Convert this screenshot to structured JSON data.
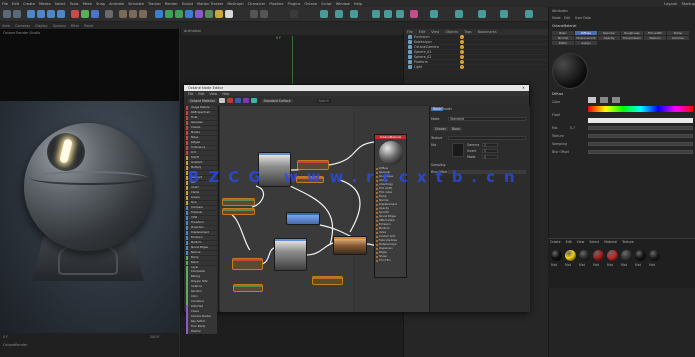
{
  "menubar": [
    "File",
    "Edit",
    "Create",
    "Modes",
    "Select",
    "Tools",
    "Mesh",
    "Snap",
    "Animate",
    "Simulate",
    "Tracker",
    "Render",
    "Sculpt",
    "Motion Tracker",
    "MoGraph",
    "Character",
    "Pipeline",
    "Plugins",
    "Octane",
    "Script",
    "Window",
    "Help"
  ],
  "layout_label": "Layout:",
  "layout_value": "Startup",
  "subbar": [
    "View",
    "Cameras",
    "Display",
    "Options",
    "Filter",
    "Panel"
  ],
  "viewport_top_label": "Octane Render Studio",
  "timeline": {
    "left": "0 F",
    "right": "200 F",
    "status": "OctaneRender"
  },
  "center_tab": "Animation",
  "center_marker": "0 F",
  "object_manager": {
    "menu": [
      "File",
      "Edit",
      "View",
      "Objects",
      "Tags",
      "Bookmarks"
    ],
    "rows": [
      "Environm",
      "Koleksiyon",
      "OctaneCamera",
      "Sphere_01",
      "Sphere_02",
      "Platform",
      "Light"
    ]
  },
  "attributes": {
    "title": "Attributes",
    "mode_tabs": [
      "Mode",
      "Edit",
      "User Data"
    ],
    "mat_name": "OctaneMaterial",
    "tabs": [
      "Basic",
      "Diffuse",
      "Specular",
      "Roughness",
      "Film width",
      "Bump",
      "Normal",
      "Displacement",
      "Opacity",
      "Transmission",
      "Medium",
      "Common",
      "Editor",
      "Assign"
    ],
    "section": "Diffuse",
    "rows": [
      "Color",
      "Float",
      "Mix",
      "Texture"
    ],
    "float_value": "0.7",
    "sampling_label": "Sampling",
    "blur_label": "Blur Offset"
  },
  "material_panel": {
    "tabs": [
      "Create",
      "Edit",
      "View",
      "Select",
      "Material",
      "Texture"
    ],
    "materials": [
      {
        "color": "#111111",
        "name": "Mat"
      },
      {
        "color": "#f2d21a",
        "name": "Mat"
      },
      {
        "color": "#2a2a2a",
        "name": "Mat"
      },
      {
        "color": "#a31d1d",
        "name": "Mat"
      },
      {
        "color": "#c12828",
        "name": "Mat"
      },
      {
        "color": "#3a3a3a",
        "name": "Mat"
      },
      {
        "color": "#151515",
        "name": "Mat"
      },
      {
        "color": "#1e1e1e",
        "name": "Mat"
      }
    ]
  },
  "node_editor": {
    "title": "Octane Node Editor",
    "menu": [
      "File",
      "Edit",
      "View",
      "Help"
    ],
    "toolbar_labels": [
      "Octane Material",
      "Diffuse",
      "Glossy",
      "Specular",
      "Standard Surface"
    ],
    "search_label": "Search",
    "node_list": [
      "Image Texture",
      "RGB Spectrum",
      "Float",
      "Gaussian",
      "Checks",
      "Marble",
      "Noise",
      "Ridged",
      "Turbulence",
      "Dirt",
      "Falloff",
      "Gradient",
      "Multiply",
      "Add",
      "Subtract",
      "Mix",
      "Invert",
      "Clamp",
      "Cosine",
      "Sine",
      "Compare",
      "Triplanar",
      "UVW",
      "Transform",
      "Projection",
      "Displacement",
      "Emission",
      "Medium",
      "Round Edges",
      "Normal",
      "Bump",
      "Blend",
      "Layer",
      "Composite",
      "Baking",
      "Polygon Side",
      "Instance",
      "Random",
      "Color",
      "Curvature",
      "Distorted",
      "Chaos",
      "Cinema Shader",
      "Ray Switch",
      "Toon Ramp",
      "Position"
    ],
    "material_node": {
      "title": "OctaneMaterial",
      "pins": [
        "Diffuse",
        "Specular",
        "Roughness",
        "Glossy",
        "Anisotropy",
        "Film width",
        "Film index",
        "Bump",
        "Normal",
        "Displacement",
        "Opacity",
        "Smooth",
        "Round Edges",
        "Affect alpha",
        "Emission",
        "Medium",
        "Index",
        "Custom AOV",
        "Fake shadows",
        "Material layer",
        "Dispersion",
        "Edges",
        "Sheen",
        "Thin Film"
      ]
    },
    "props": {
      "tabs": [
        "Basic",
        "Shader"
      ],
      "mode_label": "Mode",
      "mode_value": "Standard",
      "tab2": [
        "Shader",
        "Basic"
      ],
      "rows": [
        "Texture",
        "Mix",
        "Gamma",
        "Invert",
        "Mode",
        "Border"
      ],
      "values": [
        "1",
        "1",
        "1"
      ],
      "blur": "Blur Offset",
      "sampling": "Sampling"
    }
  },
  "watermark": "BZCG www.rrcxtb.cn",
  "colors": {
    "accent": "#4a6ea8",
    "mat_red": "#c12a2a",
    "wire": "#f2f2f2",
    "node_orange": "#c67b1e"
  }
}
